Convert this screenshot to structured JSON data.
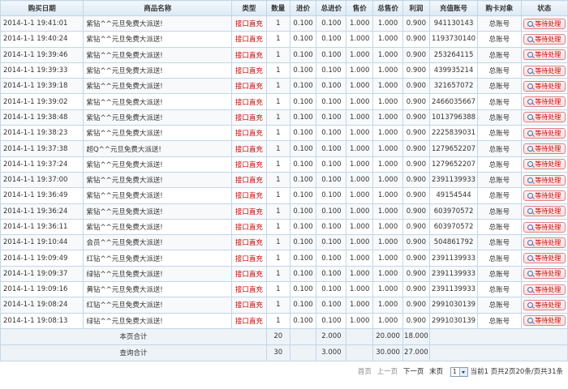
{
  "columns": [
    "购买日期",
    "商品名称",
    "类型",
    "数量",
    "进价",
    "总进价",
    "售价",
    "总售价",
    "利润",
    "充值账号",
    "购卡对象",
    "状态"
  ],
  "rows": [
    {
      "date": "2014-1-1 19:41:01",
      "name": "紫钻^^元旦免费大派送!",
      "type": "接口直充",
      "qty": "1",
      "cost": "0.100",
      "total_cost": "0.100",
      "price": "1.000",
      "total_price": "1.000",
      "profit": "0.900",
      "account": "941130143",
      "target": "总账号",
      "status": "等待处理"
    },
    {
      "date": "2014-1-1 19:40:24",
      "name": "紫钻^^元旦免费大派送!",
      "type": "接口直充",
      "qty": "1",
      "cost": "0.100",
      "total_cost": "0.100",
      "price": "1.000",
      "total_price": "1.000",
      "profit": "0.900",
      "account": "1193730140",
      "target": "总账号",
      "status": "等待处理"
    },
    {
      "date": "2014-1-1 19:39:46",
      "name": "紫钻^^元旦免费大派送!",
      "type": "接口直充",
      "qty": "1",
      "cost": "0.100",
      "total_cost": "0.100",
      "price": "1.000",
      "total_price": "1.000",
      "profit": "0.900",
      "account": "253264115",
      "target": "总账号",
      "status": "等待处理"
    },
    {
      "date": "2014-1-1 19:39:33",
      "name": "紫钻^^元旦免费大派送!",
      "type": "接口直充",
      "qty": "1",
      "cost": "0.100",
      "total_cost": "0.100",
      "price": "1.000",
      "total_price": "1.000",
      "profit": "0.900",
      "account": "439935214",
      "target": "总账号",
      "status": "等待处理"
    },
    {
      "date": "2014-1-1 19:39:18",
      "name": "紫钻^^元旦免费大派送!",
      "type": "接口直充",
      "qty": "1",
      "cost": "0.100",
      "total_cost": "0.100",
      "price": "1.000",
      "total_price": "1.000",
      "profit": "0.900",
      "account": "321657072",
      "target": "总账号",
      "status": "等待处理"
    },
    {
      "date": "2014-1-1 19:39:02",
      "name": "紫钻^^元旦免费大派送!",
      "type": "接口直充",
      "qty": "1",
      "cost": "0.100",
      "total_cost": "0.100",
      "price": "1.000",
      "total_price": "1.000",
      "profit": "0.900",
      "account": "2466035667",
      "target": "总账号",
      "status": "等待处理"
    },
    {
      "date": "2014-1-1 19:38:48",
      "name": "紫钻^^元旦免费大派送!",
      "type": "接口直充",
      "qty": "1",
      "cost": "0.100",
      "total_cost": "0.100",
      "price": "1.000",
      "total_price": "1.000",
      "profit": "0.900",
      "account": "1013796388",
      "target": "总账号",
      "status": "等待处理"
    },
    {
      "date": "2014-1-1 19:38:23",
      "name": "紫钻^^元旦免费大派送!",
      "type": "接口直充",
      "qty": "1",
      "cost": "0.100",
      "total_cost": "0.100",
      "price": "1.000",
      "total_price": "1.000",
      "profit": "0.900",
      "account": "2225839031",
      "target": "总账号",
      "status": "等待处理"
    },
    {
      "date": "2014-1-1 19:37:38",
      "name": "超Q^^元旦免费大派送!",
      "type": "接口直充",
      "qty": "1",
      "cost": "0.100",
      "total_cost": "0.100",
      "price": "1.000",
      "total_price": "1.000",
      "profit": "0.900",
      "account": "1279652207",
      "target": "总账号",
      "status": "等待处理"
    },
    {
      "date": "2014-1-1 19:37:24",
      "name": "紫钻^^元旦免费大派送!",
      "type": "接口直充",
      "qty": "1",
      "cost": "0.100",
      "total_cost": "0.100",
      "price": "1.000",
      "total_price": "1.000",
      "profit": "0.900",
      "account": "1279652207",
      "target": "总账号",
      "status": "等待处理"
    },
    {
      "date": "2014-1-1 19:37:00",
      "name": "紫钻^^元旦免费大派送!",
      "type": "接口直充",
      "qty": "1",
      "cost": "0.100",
      "total_cost": "0.100",
      "price": "1.000",
      "total_price": "1.000",
      "profit": "0.900",
      "account": "2391139933",
      "target": "总账号",
      "status": "等待处理"
    },
    {
      "date": "2014-1-1 19:36:49",
      "name": "紫钻^^元旦免费大派送!",
      "type": "接口直充",
      "qty": "1",
      "cost": "0.100",
      "total_cost": "0.100",
      "price": "1.000",
      "total_price": "1.000",
      "profit": "0.900",
      "account": "49154544",
      "target": "总账号",
      "status": "等待处理"
    },
    {
      "date": "2014-1-1 19:36:24",
      "name": "紫钻^^元旦免费大派送!",
      "type": "接口直充",
      "qty": "1",
      "cost": "0.100",
      "total_cost": "0.100",
      "price": "1.000",
      "total_price": "1.000",
      "profit": "0.900",
      "account": "603970572",
      "target": "总账号",
      "status": "等待处理"
    },
    {
      "date": "2014-1-1 19:36:11",
      "name": "紫钻^^元旦免费大派送!",
      "type": "接口直充",
      "qty": "1",
      "cost": "0.100",
      "total_cost": "0.100",
      "price": "1.000",
      "total_price": "1.000",
      "profit": "0.900",
      "account": "603970572",
      "target": "总账号",
      "status": "等待处理"
    },
    {
      "date": "2014-1-1 19:10:44",
      "name": "会员^^元旦免费大派送!",
      "type": "接口直充",
      "qty": "1",
      "cost": "0.100",
      "total_cost": "0.100",
      "price": "1.000",
      "total_price": "1.000",
      "profit": "0.900",
      "account": "504861792",
      "target": "总账号",
      "status": "等待处理"
    },
    {
      "date": "2014-1-1 19:09:49",
      "name": "红钻^^元旦免费大派送!",
      "type": "接口直充",
      "qty": "1",
      "cost": "0.100",
      "total_cost": "0.100",
      "price": "1.000",
      "total_price": "1.000",
      "profit": "0.900",
      "account": "2391139933",
      "target": "总账号",
      "status": "等待处理"
    },
    {
      "date": "2014-1-1 19:09:37",
      "name": "绿钻^^元旦免费大派送!",
      "type": "接口直充",
      "qty": "1",
      "cost": "0.100",
      "total_cost": "0.100",
      "price": "1.000",
      "total_price": "1.000",
      "profit": "0.900",
      "account": "2391139933",
      "target": "总账号",
      "status": "等待处理"
    },
    {
      "date": "2014-1-1 19:09:16",
      "name": "黄钻^^元旦免费大派送!",
      "type": "接口直充",
      "qty": "1",
      "cost": "0.100",
      "total_cost": "0.100",
      "price": "1.000",
      "total_price": "1.000",
      "profit": "0.900",
      "account": "2391139933",
      "target": "总账号",
      "status": "等待处理"
    },
    {
      "date": "2014-1-1 19:08:24",
      "name": "红钻^^元旦免费大派送!",
      "type": "接口直充",
      "qty": "1",
      "cost": "0.100",
      "total_cost": "0.100",
      "price": "1.000",
      "total_price": "1.000",
      "profit": "0.900",
      "account": "2991030139",
      "target": "总账号",
      "status": "等待处理"
    },
    {
      "date": "2014-1-1 19:08:13",
      "name": "绿钻^^元旦免费大派送!",
      "type": "接口直充",
      "qty": "1",
      "cost": "0.100",
      "total_cost": "0.100",
      "price": "1.000",
      "total_price": "1.000",
      "profit": "0.900",
      "account": "2991030139",
      "target": "总账号",
      "status": "等待处理"
    }
  ],
  "totals": {
    "page": {
      "label": "本页合计",
      "qty": "20",
      "total_cost": "2.000",
      "total_price": "20.000",
      "profit": "18.000"
    },
    "query": {
      "label": "查询合计",
      "qty": "30",
      "total_cost": "3.000",
      "total_price": "30.000",
      "profit": "27.000"
    }
  },
  "pager": {
    "first": "首页",
    "prev": "上一页",
    "next": "下一页",
    "last": "末页",
    "page_value": "1",
    "summary": "当前1 页共2页20条/页共31条"
  },
  "colors": {
    "header_bg": "#dbe9f4",
    "border": "#c3d6e6",
    "type_text": "#cc0000",
    "status_border": "#e08080",
    "status_bg": "#ffdede"
  },
  "icons": {
    "status_button": "magnifier-icon",
    "page_select": "chevron-down-icon"
  }
}
